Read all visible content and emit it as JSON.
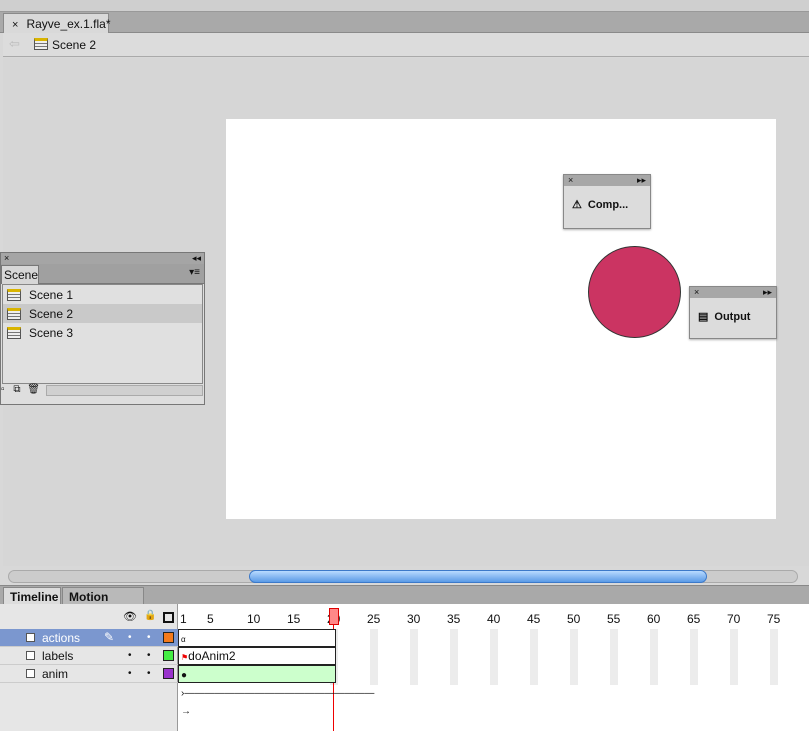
{
  "document": {
    "tab_label": "Rayve_ex.1.fla*",
    "close_glyph": "×"
  },
  "edit_bar": {
    "scene_label": "Scene 2"
  },
  "floating_panels": [
    {
      "label": "Comp...",
      "icon": "warning-icon"
    },
    {
      "label": "Output",
      "icon": "output-icon"
    }
  ],
  "scene_panel": {
    "tab": "Scene",
    "items": [
      "Scene 1",
      "Scene 2",
      "Scene 3"
    ],
    "selected": "Scene 2"
  },
  "stage": {
    "circle_color": "#cb3462",
    "background": "#ffffff"
  },
  "timeline": {
    "tabs": [
      "Timeline",
      "Motion Editor"
    ],
    "active_tab": "Timeline",
    "frame_ticks": [
      "1",
      "5",
      "10",
      "15",
      "20",
      "25",
      "30",
      "35",
      "40",
      "45",
      "50",
      "55",
      "60",
      "65",
      "70",
      "75"
    ],
    "current_frame": 20,
    "layers": [
      {
        "name": "actions",
        "color": "#f47a1c",
        "selected": true,
        "frame_label": ""
      },
      {
        "name": "labels",
        "color": "#44ee44",
        "selected": false,
        "frame_label": "doAnim2"
      },
      {
        "name": "anim",
        "color": "#9933cc",
        "selected": false,
        "frame_label": ""
      }
    ]
  }
}
